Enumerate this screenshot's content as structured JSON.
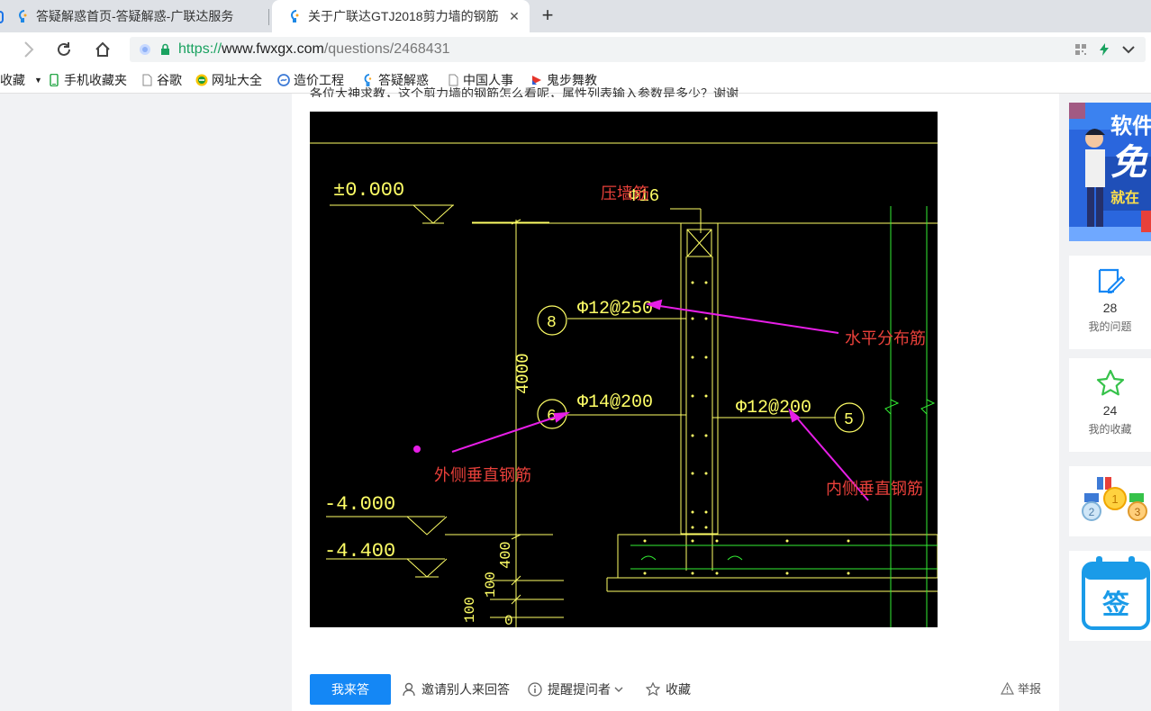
{
  "tabs": [
    {
      "title": "答疑解惑首页-答疑解惑-广联达服务",
      "active": false
    },
    {
      "title": "关于广联达GTJ2018剪力墙的钢筋",
      "active": true
    }
  ],
  "toolbar": {
    "url_scheme": "https://",
    "url_host": "www.fwxgx.com",
    "url_path": "/questions/2468431"
  },
  "bookmarks": [
    {
      "label": "收藏",
      "icon": "star-menu-icon"
    },
    {
      "label": "手机收藏夹",
      "icon": "phone-icon"
    },
    {
      "label": "谷歌",
      "icon": "page-icon"
    },
    {
      "label": "网址大全",
      "icon": "web-directory-icon"
    },
    {
      "label": "造价工程",
      "icon": "cost-site-icon"
    },
    {
      "label": "答疑解惑",
      "icon": "qa-site-icon"
    },
    {
      "label": "中国人事",
      "icon": "page-icon"
    },
    {
      "label": "鬼步舞教",
      "icon": "video-site-icon"
    }
  ],
  "question": {
    "text": "各位大神求教，这个剪力墙的钢筋怎么看呢，属性列表输入参数是多少？谢谢"
  },
  "drawing": {
    "elev_top": "±0.000",
    "elev_mid": "-4.000",
    "elev_bot": "-4.400",
    "dim_wall": "4000",
    "dim_slab": "400",
    "dim_100a": "100",
    "dim_100b": "100",
    "dim_0": "0",
    "top_bar": "Φ16",
    "rebar_8": "Φ12@250",
    "rebar_6": "Φ14@200",
    "rebar_5": "Φ12@200",
    "tag_8": "8",
    "tag_6": "6",
    "tag_5": "5",
    "ann_press": "压墙筋",
    "ann_horizontal": "水平分布筋",
    "ann_outer": "外侧垂直钢筋",
    "ann_inner": "内侧垂直钢筋"
  },
  "actions": {
    "answer": "我来答",
    "invite": "邀请别人来回答",
    "remind": "提醒提问者",
    "favorite": "收藏",
    "report": "举报"
  },
  "rail": {
    "ad_text_1": "软件",
    "ad_text_2": "免",
    "ad_text_3": "就在",
    "my_questions_count": "28",
    "my_questions_label": "我的问题",
    "my_favorites_count": "24",
    "my_favorites_label": "我的收藏",
    "medal_1": "1",
    "medal_2": "2",
    "medal_3": "3",
    "sign_label": "签"
  }
}
